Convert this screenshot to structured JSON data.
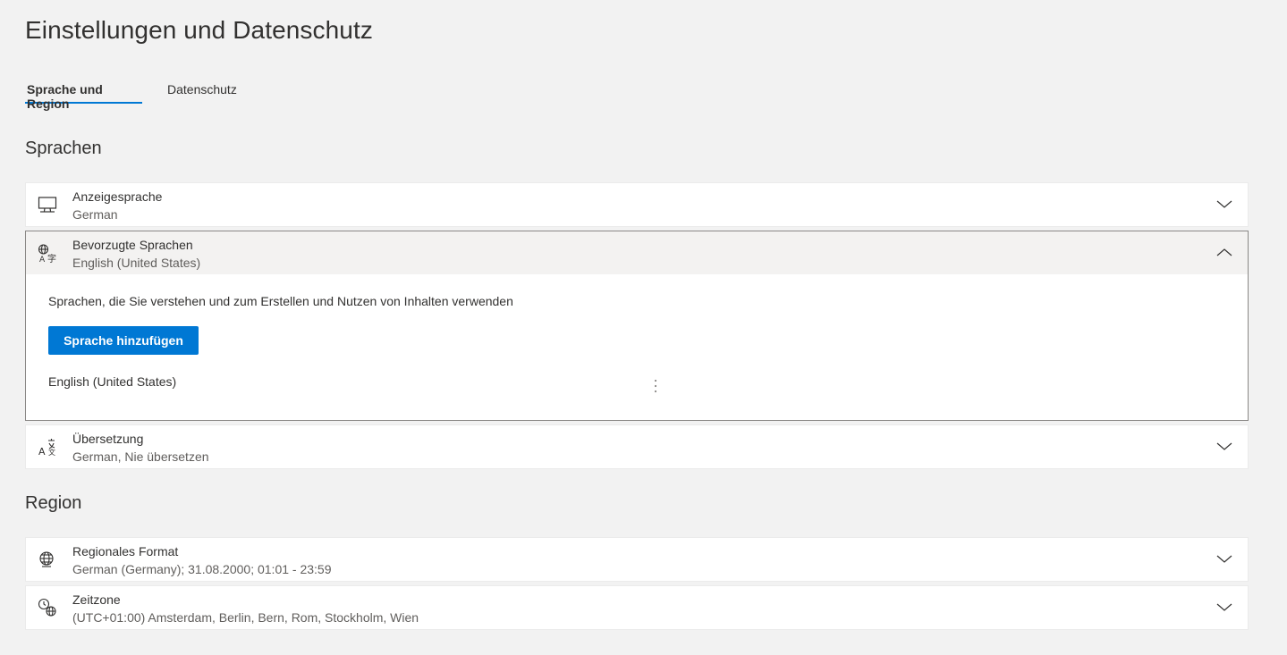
{
  "page": {
    "title": "Einstellungen und Datenschutz"
  },
  "tabs": [
    {
      "label": "Sprache und Region",
      "active": true
    },
    {
      "label": "Datenschutz",
      "active": false
    }
  ],
  "languages_section": {
    "heading": "Sprachen",
    "cards": [
      {
        "icon": "monitor-icon",
        "title": "Anzeigesprache",
        "subtitle": "German",
        "expanded": false
      },
      {
        "icon": "language-icon",
        "title": "Bevorzugte Sprachen",
        "subtitle": "English (United States)",
        "expanded": true,
        "body": {
          "description": "Sprachen, die Sie verstehen und zum Erstellen und Nutzen von Inhalten verwenden",
          "add_button_label": "Sprache hinzufügen",
          "languages": [
            "English (United States)"
          ]
        }
      },
      {
        "icon": "translate-icon",
        "title": "Übersetzung",
        "subtitle": "German, Nie übersetzen",
        "expanded": false
      }
    ]
  },
  "region_section": {
    "heading": "Region",
    "cards": [
      {
        "icon": "globe-format-icon",
        "title": "Regionales Format",
        "subtitle": "German (Germany); 31.08.2000; 01:01 - 23:59",
        "expanded": false
      },
      {
        "icon": "clock-globe-icon",
        "title": "Zeitzone",
        "subtitle": "(UTC+01:00) Amsterdam, Berlin, Bern, Rom, Stockholm, Wien",
        "expanded": false
      }
    ]
  },
  "colors": {
    "accent": "#0078d4",
    "background": "#f2f2f2",
    "card": "#ffffff"
  }
}
